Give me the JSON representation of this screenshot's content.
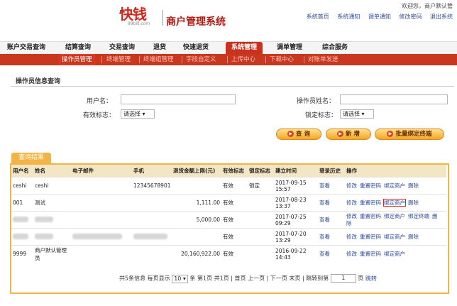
{
  "header": {
    "logo_text": "快钱",
    "logo_sub": "99bill.com",
    "system_title": "商户管理系统",
    "welcome": "欢迎您，商户默认管",
    "links": [
      "系统首页",
      "系统通知",
      "调单通知",
      "修改密码",
      "退出系统"
    ]
  },
  "main_nav": [
    "账户交易查询",
    "结算查询",
    "交易查询",
    "退货",
    "快速退货",
    "系统管理",
    "调单管理",
    "综合服务"
  ],
  "main_nav_active": "系统管理",
  "sub_nav": [
    "操作员管理",
    "终端管理",
    "终端组管理",
    "字段自定义",
    "上传中心",
    "下载中心",
    "对账单发送"
  ],
  "sub_nav_active": "操作员管理",
  "query": {
    "section_title": "操作员信息查询",
    "username_label": "用户名：",
    "username_value": "",
    "opname_label": "操作员姓名：",
    "opname_value": "",
    "valid_label": "有效标志：",
    "valid_value": "请选择",
    "lock_label": "锁定标志：",
    "lock_value": "请选择",
    "btn_query": "查 询",
    "btn_add": "新 增",
    "btn_batch": "批量绑定终端"
  },
  "results": {
    "tab_label": "查询结果",
    "columns": [
      "用户名",
      "姓名",
      "电子邮件",
      "手机",
      "退货金额上限(元)",
      "有效标志",
      "锁定标志",
      "建立时间",
      "登录历史",
      "操作"
    ],
    "rows": [
      {
        "username": "ceshi",
        "name": "ceshi",
        "email": "",
        "phone": "12345678901",
        "limit": "",
        "valid": "有效",
        "locked": "锁定",
        "created": "2017-09-15 15:57",
        "history": "查看",
        "ops": [
          "修改",
          "重置密码",
          "绑定商户",
          "删除"
        ]
      },
      {
        "username": "001",
        "name": "测试",
        "email": "",
        "phone": "",
        "limit": "1,111.00",
        "valid": "有效",
        "locked": "",
        "created": "2017-08-23 13:37",
        "history": "查看",
        "ops": [
          "修改",
          "重置密码",
          "绑定商户",
          "删除"
        ]
      },
      {
        "username": "",
        "name": "",
        "email": "",
        "phone": "",
        "limit": "5,000.00",
        "valid": "有效",
        "locked": "",
        "created": "2017-07-25 09:29",
        "history": "查看",
        "ops": [
          "修改",
          "重置密码",
          "绑定商户",
          "绑定终端",
          "删除"
        ]
      },
      {
        "username": "",
        "name": "",
        "email": "",
        "phone": "",
        "limit": "",
        "valid": "有效",
        "locked": "",
        "created": "2017-07-20 13:29",
        "history": "查看",
        "ops": [
          "修改",
          "重置密码",
          "绑定商户",
          "删除"
        ]
      },
      {
        "username": "9999",
        "name": "商户默认管理员",
        "email": "",
        "phone": "",
        "limit": "20,160,922.00",
        "valid": "有效",
        "locked": "",
        "created": "2016-09-22 14:43",
        "history": "查看",
        "ops": [
          "修改",
          "重置密码",
          "绑定商户"
        ]
      }
    ]
  },
  "pager": {
    "info": "共5条信息 每页显示",
    "per_page": "10",
    "page_info": "条 第1页 共1页 | 首页 上一页 | 下一页 末页 | 跳转到第",
    "page_input": "1",
    "page_suffix": "页",
    "jump": "跳转"
  }
}
